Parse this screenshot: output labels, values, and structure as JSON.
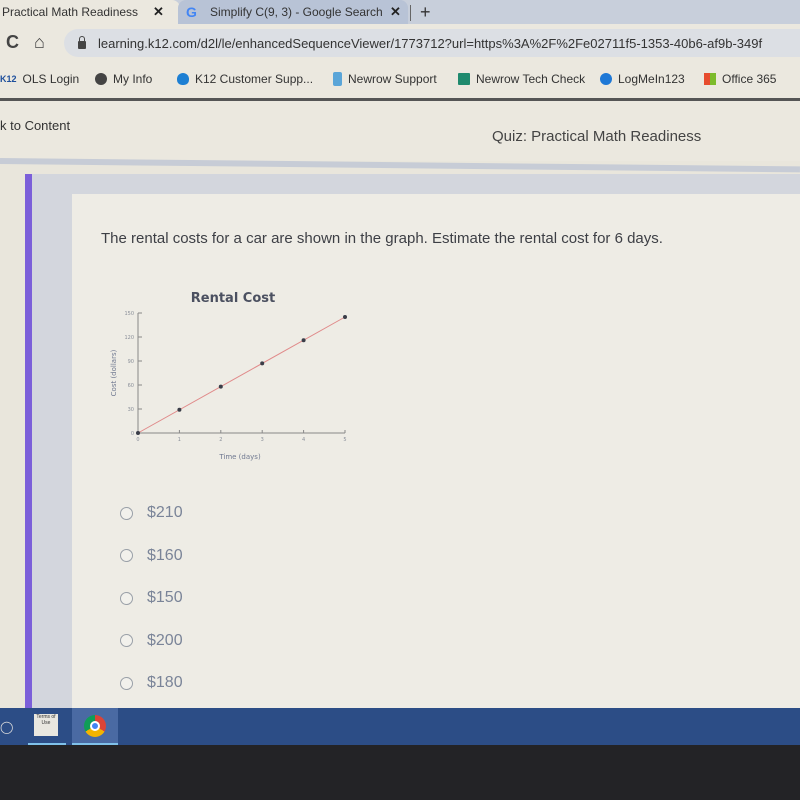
{
  "browser": {
    "tabs": [
      {
        "title": "Practical Math Readiness",
        "active": true
      },
      {
        "title": "Simplify C(9, 3) - Google Search",
        "active": false
      }
    ],
    "close_glyph": "✕",
    "new_tab_glyph": "+",
    "reload_glyph": "C",
    "home_glyph": "⌂",
    "url": "learning.k12.com/d2l/le/enhancedSequenceViewer/1773712?url=https%3A%2F%2Fe02711f5-1353-40b6-af9b-349f",
    "bookmarks": [
      {
        "label": "OLS Login",
        "icon": "k12-icon",
        "prefix": "K12"
      },
      {
        "label": "My Info",
        "icon": "globe-icon"
      },
      {
        "label": "K12 Customer Supp...",
        "icon": "cloud-icon"
      },
      {
        "label": "Newrow Support",
        "icon": "newrow-icon"
      },
      {
        "label": "Newrow Tech Check",
        "icon": "newrow-check-icon"
      },
      {
        "label": "LogMeIn123",
        "icon": "logmein-icon"
      },
      {
        "label": "Office 365",
        "icon": "office-icon"
      }
    ]
  },
  "page": {
    "back_link": "k to Content",
    "quiz_title": "Quiz: Practical Math Readiness",
    "question": "The rental costs for a car are shown in the graph. Estimate the rental cost for 6 days.",
    "answers": [
      "$210",
      "$160",
      "$150",
      "$200",
      "$180"
    ]
  },
  "taskbar": {
    "terms_tile": "Terms of Use"
  },
  "colors": {
    "accent": "#7b5fd9",
    "trend_line": "#e08a8a",
    "taskbar": "#2c4d86"
  },
  "chart_data": {
    "type": "scatter",
    "title": "Rental Cost",
    "xlabel": "Time (days)",
    "ylabel": "Cost (dollars)",
    "x": [
      0,
      1,
      2,
      3,
      4,
      5
    ],
    "y": [
      0,
      29,
      58,
      87,
      116,
      145
    ],
    "xticks": [
      0,
      1,
      2,
      3,
      4,
      5
    ],
    "yticks": [
      0,
      30,
      60,
      90,
      120,
      150
    ],
    "xlim": [
      0,
      5
    ],
    "ylim": [
      0,
      150
    ],
    "trend_line": true,
    "grid": false
  }
}
